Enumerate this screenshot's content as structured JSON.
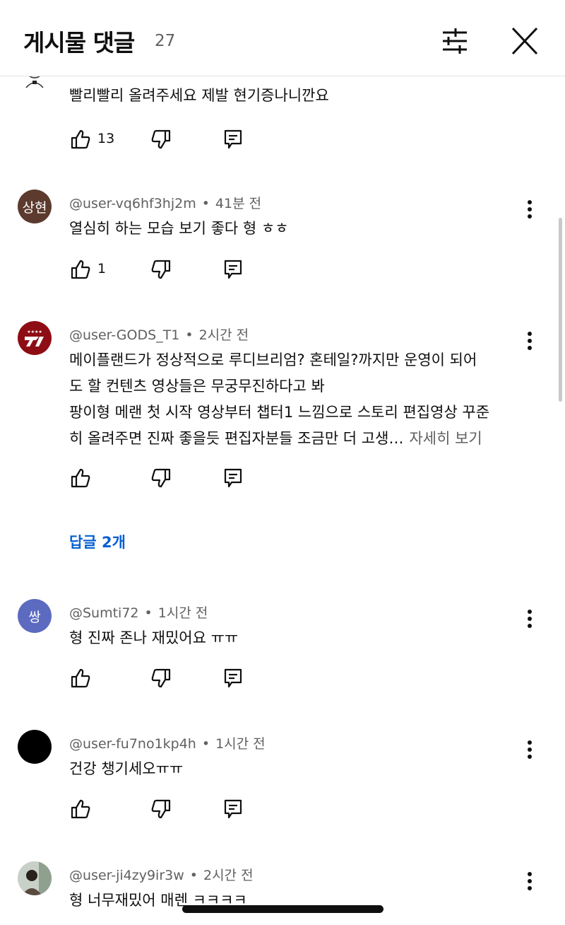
{
  "header": {
    "title": "게시물 댓글",
    "count": "27"
  },
  "comments": [
    {
      "author": "",
      "time": "",
      "text_lines": [
        "빨리빨리 올려주세요 제발 현기증나니깐요"
      ],
      "more": "",
      "likes": "13",
      "replies": ""
    },
    {
      "author": "@user-vq6hf3hj2m",
      "time": "41분 전",
      "avatar_text": "상현",
      "avatar_color": "#5c3a2e",
      "text_lines": [
        "열심히 하는 모습 보기 좋다 형 ㅎㅎ"
      ],
      "more": "",
      "likes": "1",
      "replies": ""
    },
    {
      "author": "@user-GODS_T1",
      "time": "2시간 전",
      "avatar_color": "#8e0d14",
      "text_lines": [
        "메이플랜드가 정상적으로 루디브리엄? 혼테일?까지만 운영이 되어",
        "도 할 컨텐츠 영상들은 무궁무진하다고 봐",
        "팡이형 메랜 첫 시작 영상부터 챕터1 느낌으로 스토리 편집영상 꾸준",
        "히 올려주면 진짜 좋을듯 편집자분들 조금만 더 고생…"
      ],
      "more": "자세히 보기",
      "likes": "",
      "replies": "답글 2개"
    },
    {
      "author": "@Sumti72",
      "time": "1시간 전",
      "avatar_text": "쌍",
      "avatar_color": "#5c6bc0",
      "text_lines": [
        "형 진짜 존나 재밌어요 ㅠㅠ"
      ],
      "more": "",
      "likes": "",
      "replies": ""
    },
    {
      "author": "@user-fu7no1kp4h",
      "time": "1시간 전",
      "avatar_color": "#000000",
      "text_lines": [
        "건강 챙기세오ㅠㅠ"
      ],
      "more": "",
      "likes": "",
      "replies": ""
    },
    {
      "author": "@user-ji4zy9ir3w",
      "time": "2시간 전",
      "avatar_color": "#9aa89a",
      "text_lines": [
        "형 너무재밌어 매렌 ㅋㅋㅋㅋ"
      ],
      "more": "",
      "likes": "",
      "replies": ""
    }
  ],
  "icons": {
    "like": "thumbs-up-icon",
    "dislike": "thumbs-down-icon",
    "reply": "reply-icon",
    "menu": "more-vert-icon",
    "filter": "sliders-icon",
    "close": "close-icon"
  },
  "colors": {
    "link": "#065fd4",
    "secondary_text": "#606060"
  }
}
